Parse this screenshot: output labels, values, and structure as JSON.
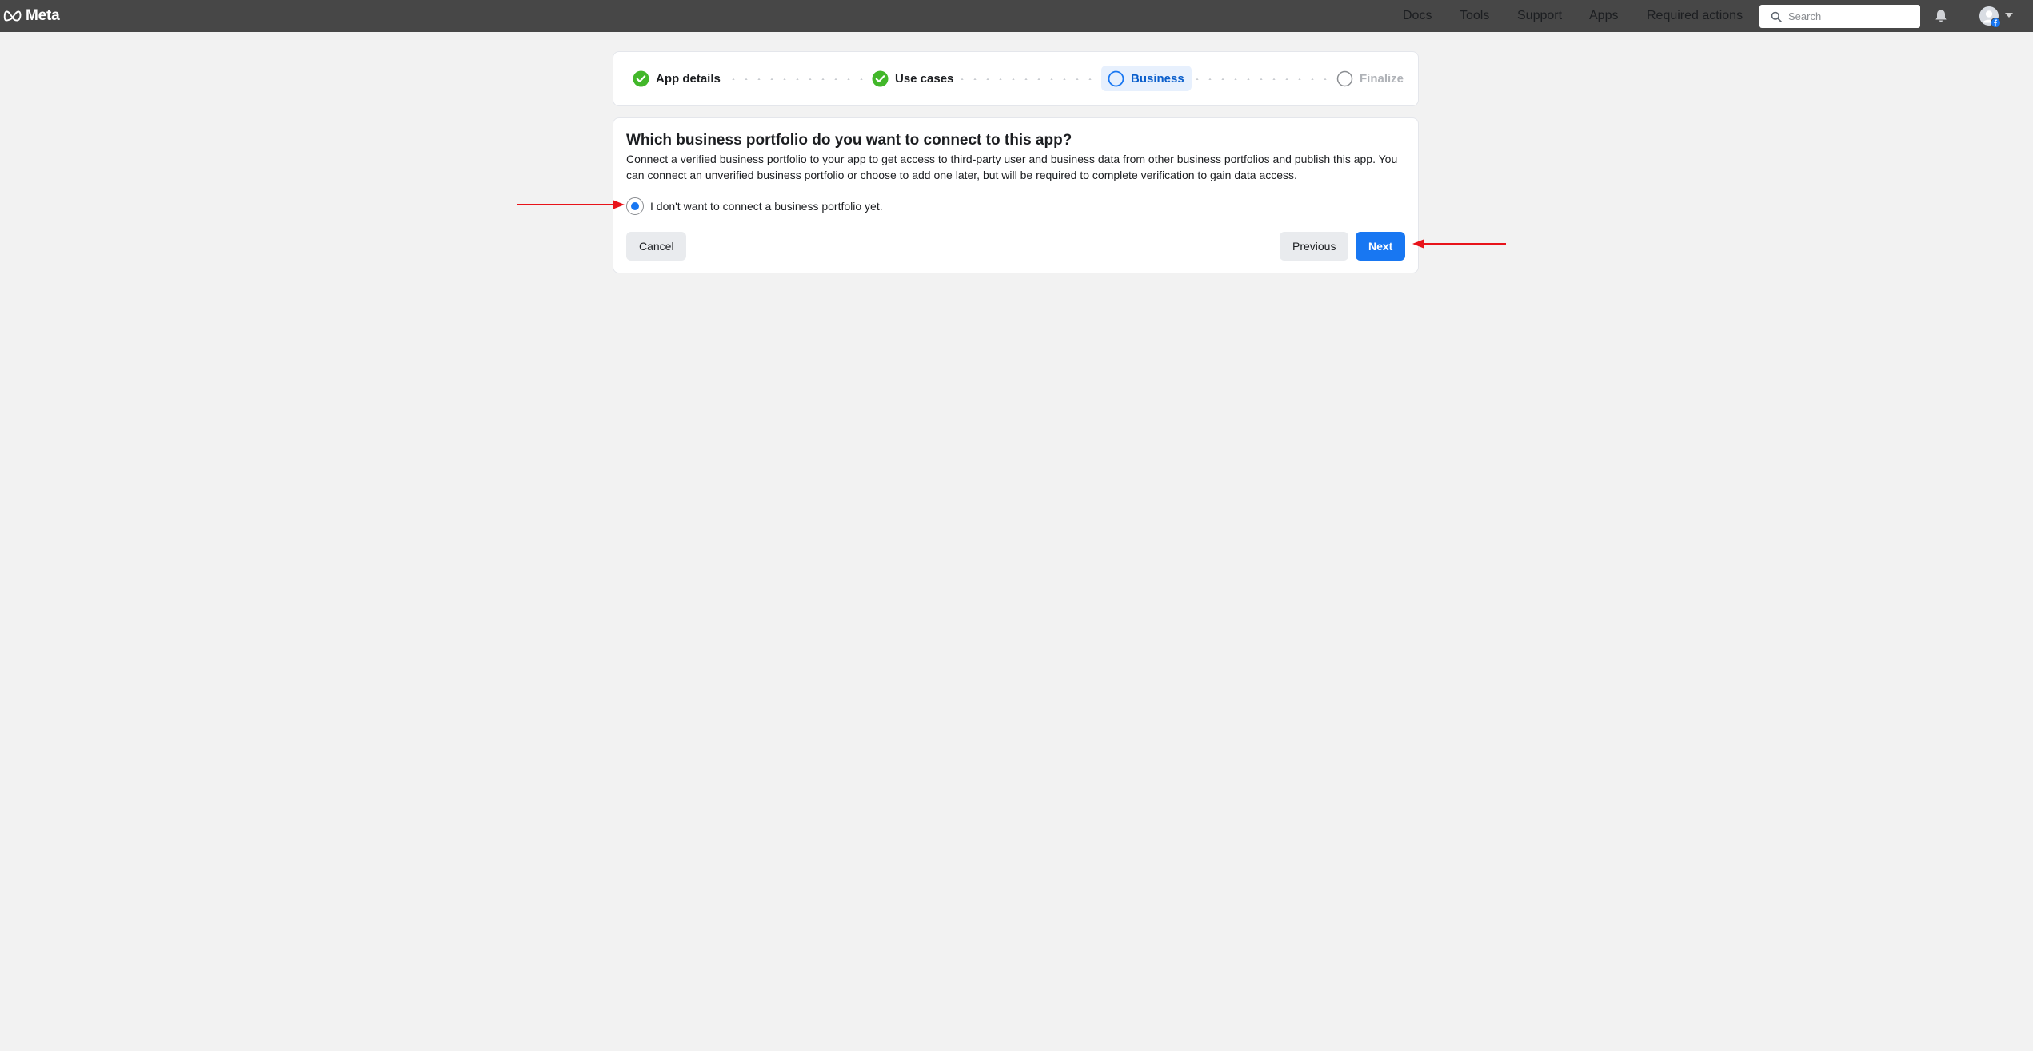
{
  "header": {
    "brand": "Meta",
    "nav": [
      {
        "label": "Docs"
      },
      {
        "label": "Tools"
      },
      {
        "label": "Support"
      },
      {
        "label": "Apps"
      },
      {
        "label": "Required actions"
      }
    ],
    "search": {
      "placeholder": "Search",
      "value": ""
    },
    "icons": [
      "meta-logo-icon",
      "search-icon",
      "bell-icon",
      "avatar",
      "facebook-badge-icon",
      "chevron-down-icon"
    ],
    "bar_color": "#474747"
  },
  "stepper": {
    "steps": [
      {
        "label": "App details",
        "state": "complete"
      },
      {
        "label": "Use cases",
        "state": "complete"
      },
      {
        "label": "Business",
        "state": "active"
      },
      {
        "label": "Finalize",
        "state": "pending"
      }
    ],
    "colors": {
      "complete": "#42b72a",
      "active": "#1877f2",
      "pending": "#b0b3b8"
    }
  },
  "card": {
    "title": "Which business portfolio do you want to connect to this app?",
    "description": "Connect a verified business portfolio to your app to get access to third-party user and business data from other business portfolios and publish this app. You can connect an unverified business portfolio or choose to add one later, but will be required to complete verification to gain data access.",
    "option": {
      "label": "I don't want to connect a business portfolio yet.",
      "selected": true
    },
    "cancel_label": "Cancel",
    "previous_label": "Previous",
    "next_label": "Next"
  },
  "annotations": {
    "arrow_color": "#e8131a"
  },
  "colors": {
    "primary": "#1877f2",
    "background": "#f2f2f2"
  }
}
